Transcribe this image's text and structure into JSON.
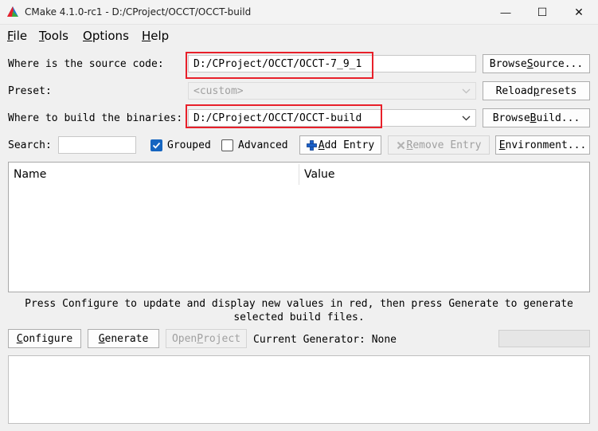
{
  "window": {
    "title": "CMake 4.1.0-rc1 - D:/CProject/OCCT/OCCT-build",
    "minimize_glyph": "—",
    "maximize_glyph": "☐",
    "close_glyph": "✕"
  },
  "menu": [
    {
      "label": "File",
      "mnemonic": "F",
      "rest": "ile"
    },
    {
      "label": "Tools",
      "mnemonic": "T",
      "rest": "ools"
    },
    {
      "label": "Options",
      "mnemonic": "O",
      "rest": "ptions"
    },
    {
      "label": "Help",
      "mnemonic": "H",
      "rest": "elp"
    }
  ],
  "source": {
    "label": "Where is the source code:",
    "value": "D:/CProject/OCCT/OCCT-7_9_1",
    "browse_pre": "Browse ",
    "browse_mn": "S",
    "browse_post": "ource..."
  },
  "preset": {
    "label": "Preset:",
    "value": "<custom>",
    "reload_pre": "Reload ",
    "reload_mn": "p",
    "reload_post": "resets"
  },
  "build": {
    "label": "Where to build the binaries:",
    "value": "D:/CProject/OCCT/OCCT-build",
    "browse_pre": "Browse ",
    "browse_mn": "B",
    "browse_post": "uild..."
  },
  "search": {
    "label": "Search:",
    "value": ""
  },
  "options": {
    "grouped_label": "Grouped",
    "grouped_checked": true,
    "advanced_label": "Advanced",
    "advanced_checked": false,
    "add_entry_mn": "A",
    "add_entry_post": "dd Entry",
    "remove_entry_mn": "R",
    "remove_entry_post": "emove Entry",
    "environment_mn": "E",
    "environment_post": "nvironment..."
  },
  "table": {
    "columns": [
      "Name",
      "Value"
    ],
    "rows": []
  },
  "status": {
    "line1": "Press Configure to update and display new values in red, then press Generate to generate",
    "line2": "selected build files."
  },
  "actions": {
    "configure_mn": "C",
    "configure_post": "onfigure",
    "generate_mn": "G",
    "generate_post": "enerate",
    "open_pre": "Open ",
    "open_mn": "P",
    "open_post": "roject",
    "generator_label": "Current Generator: None"
  },
  "colors": {
    "highlight": "#e8202a",
    "checkbox_accent": "#1565c0"
  },
  "icons": [
    "cmake-logo-icon",
    "minimize-icon",
    "maximize-icon",
    "close-icon",
    "chevron-down-icon",
    "plus-icon",
    "remove-icon"
  ]
}
